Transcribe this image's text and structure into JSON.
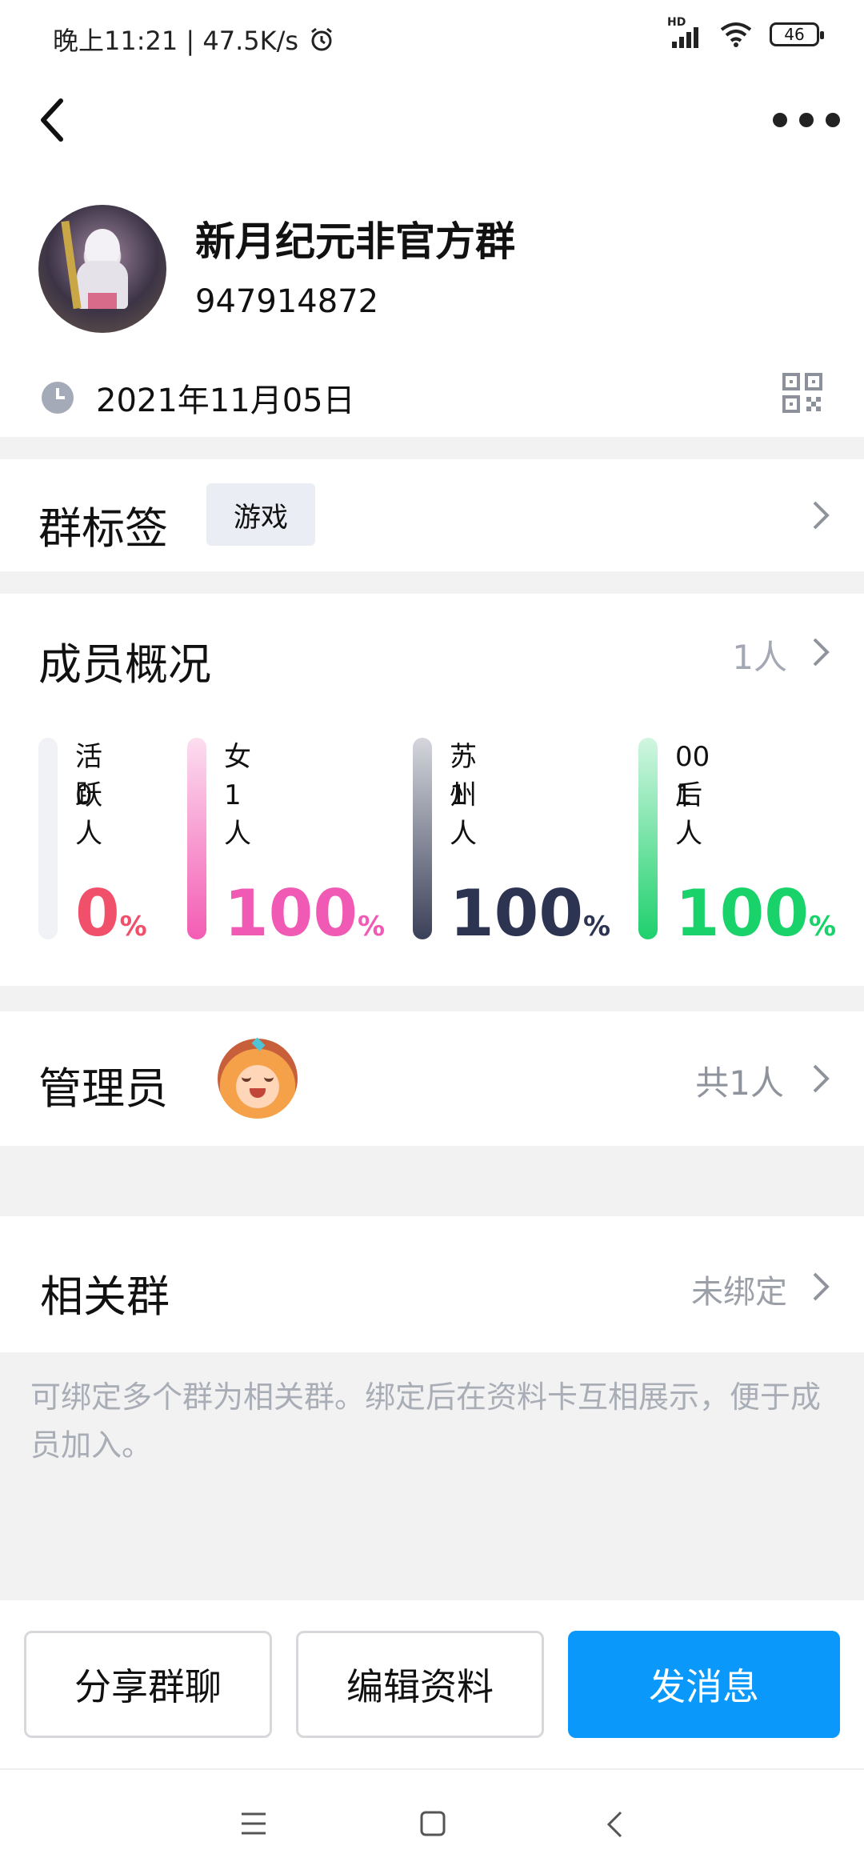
{
  "status_bar": {
    "time_speed": "晚上11:21 | 47.5K/s",
    "network": "HD",
    "battery": "46"
  },
  "group": {
    "name": "新月纪元非官方群",
    "id": "947914872",
    "date": "2021年11月05日"
  },
  "tags_row": {
    "title": "群标签",
    "tag": "游戏"
  },
  "members": {
    "title": "成员概况",
    "count": "1人",
    "stats": [
      {
        "label": "活跃",
        "count": "0人",
        "percent": "0",
        "unit": "%",
        "value": 0,
        "color": "#f0506a",
        "bar_color": "#f1f2f6"
      },
      {
        "label": "女",
        "count": "1人",
        "percent": "100",
        "unit": "%",
        "value": 100,
        "color": "#f05ab4",
        "bar_color": "#f35cb3"
      },
      {
        "label": "苏州",
        "count": "1人",
        "percent": "100",
        "unit": "%",
        "value": 100,
        "color": "#2c3452",
        "bar_color": "#3a4058"
      },
      {
        "label": "00后",
        "count": "1人",
        "percent": "100",
        "unit": "%",
        "value": 100,
        "color": "#19d26a",
        "bar_color": "#1fd06d"
      }
    ]
  },
  "admins": {
    "title": "管理员",
    "count": "共1人"
  },
  "related": {
    "title": "相关群",
    "status": "未绑定",
    "description": "可绑定多个群为相关群。绑定后在资料卡互相展示，便于成员加入。"
  },
  "actions": {
    "share": "分享群聊",
    "edit": "编辑资料",
    "message": "发消息"
  },
  "colors": {
    "primary": "#0a99fb",
    "separator": "#f2f2f3"
  }
}
